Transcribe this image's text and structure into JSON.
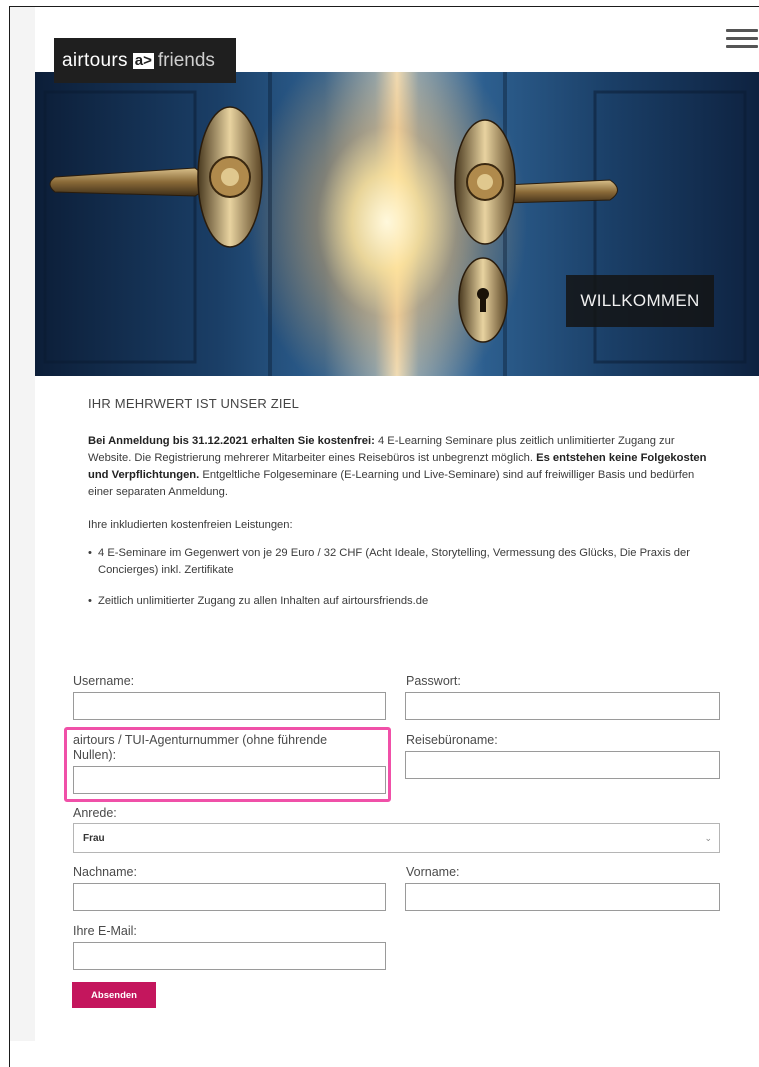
{
  "logo": {
    "text_left": "airtours",
    "mark": "a>",
    "text_right": "friends"
  },
  "hero": {
    "welcome": "WILLKOMMEN"
  },
  "content": {
    "heading": "IHR MEHRWERT IST UNSER ZIEL",
    "p1_bold": "Bei Anmeldung bis 31.12.2021 erhalten Sie kostenfrei:",
    "p1_text": " 4 E-Learning Seminare plus zeitlich unlimitierter Zugang zur Website. Die Registrierung mehrerer Mitarbeiter eines Reisebüros ist unbegrenzt möglich. ",
    "p1_bold2": "Es entstehen keine Folgekosten und Verpflichtungen.",
    "p1_text2": " Entgeltliche Folgeseminare (E-Learning und Live-Seminare) sind auf freiwilliger Basis und bedürfen einer separaten Anmeldung.",
    "p2": "Ihre inkludierten kostenfreien Leistungen:",
    "bullets": [
      "4 E-Seminare im Gegenwert von je 29 Euro / 32 CHF (Acht Ideale, Storytelling, Vermessung des Glücks, Die Praxis der Concierges) inkl. Zertifikate",
      "Zeitlich unlimitierter Zugang zu allen Inhalten auf airtoursfriends.de"
    ]
  },
  "form": {
    "username_label": "Username:",
    "password_label": "Passwort:",
    "agency_number_label": "airtours / TUI-Agenturnummer (ohne führende Nullen):",
    "agency_name_label": "Reisebüroname:",
    "salutation_label": "Anrede:",
    "salutation_value": "Frau",
    "lastname_label": "Nachname:",
    "firstname_label": "Vorname:",
    "email_label": "Ihre E-Mail:",
    "submit_label": "Absenden"
  },
  "colors": {
    "accent": "#c4165d",
    "highlight": "#f050a8",
    "logo_bg": "#1f1f1f"
  },
  "icons": {
    "menu": "hamburger-icon",
    "dropdown": "chevron-down-icon"
  }
}
